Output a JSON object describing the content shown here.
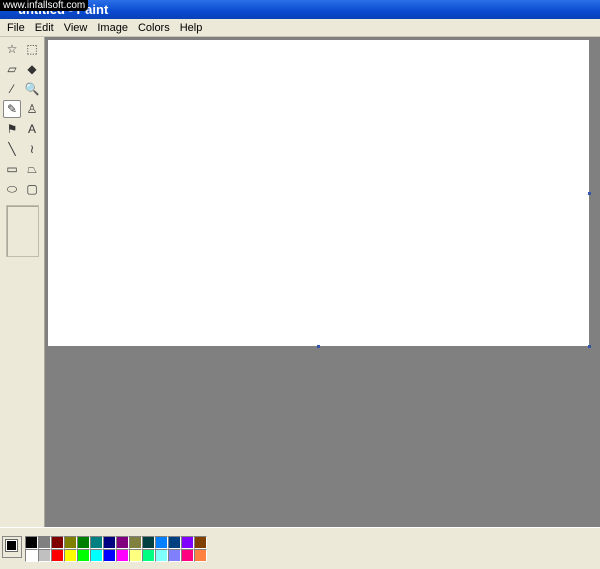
{
  "window": {
    "title": "untitled - Paint",
    "watermark": "www.infallsoft.com"
  },
  "menu": [
    "File",
    "Edit",
    "View",
    "Image",
    "Colors",
    "Help"
  ],
  "tools": [
    {
      "name": "free-form-select",
      "glyph": "☆"
    },
    {
      "name": "rect-select",
      "glyph": "⬚"
    },
    {
      "name": "eraser",
      "glyph": "▱"
    },
    {
      "name": "fill",
      "glyph": "◆"
    },
    {
      "name": "pick-color",
      "glyph": "⁄"
    },
    {
      "name": "magnifier",
      "glyph": "🔍"
    },
    {
      "name": "pencil",
      "glyph": "✎",
      "selected": true
    },
    {
      "name": "brush",
      "glyph": "♙"
    },
    {
      "name": "airbrush",
      "glyph": "⚑"
    },
    {
      "name": "text",
      "glyph": "A"
    },
    {
      "name": "line",
      "glyph": "╲"
    },
    {
      "name": "curve",
      "glyph": "≀"
    },
    {
      "name": "rectangle",
      "glyph": "▭"
    },
    {
      "name": "polygon",
      "glyph": "⏢"
    },
    {
      "name": "ellipse",
      "glyph": "⬭"
    },
    {
      "name": "rounded-rectangle",
      "glyph": "▢"
    }
  ],
  "colors": {
    "foreground": "#000000",
    "background": "#ffffff"
  },
  "palette": [
    "#000000",
    "#808080",
    "#800000",
    "#808000",
    "#008000",
    "#008080",
    "#000080",
    "#800080",
    "#808040",
    "#004040",
    "#0080ff",
    "#004080",
    "#8000ff",
    "#804000",
    "#ffffff",
    "#c0c0c0",
    "#ff0000",
    "#ffff00",
    "#00ff00",
    "#00ffff",
    "#0000ff",
    "#ff00ff",
    "#ffff80",
    "#00ff80",
    "#80ffff",
    "#8080ff",
    "#ff0080",
    "#ff8040"
  ]
}
